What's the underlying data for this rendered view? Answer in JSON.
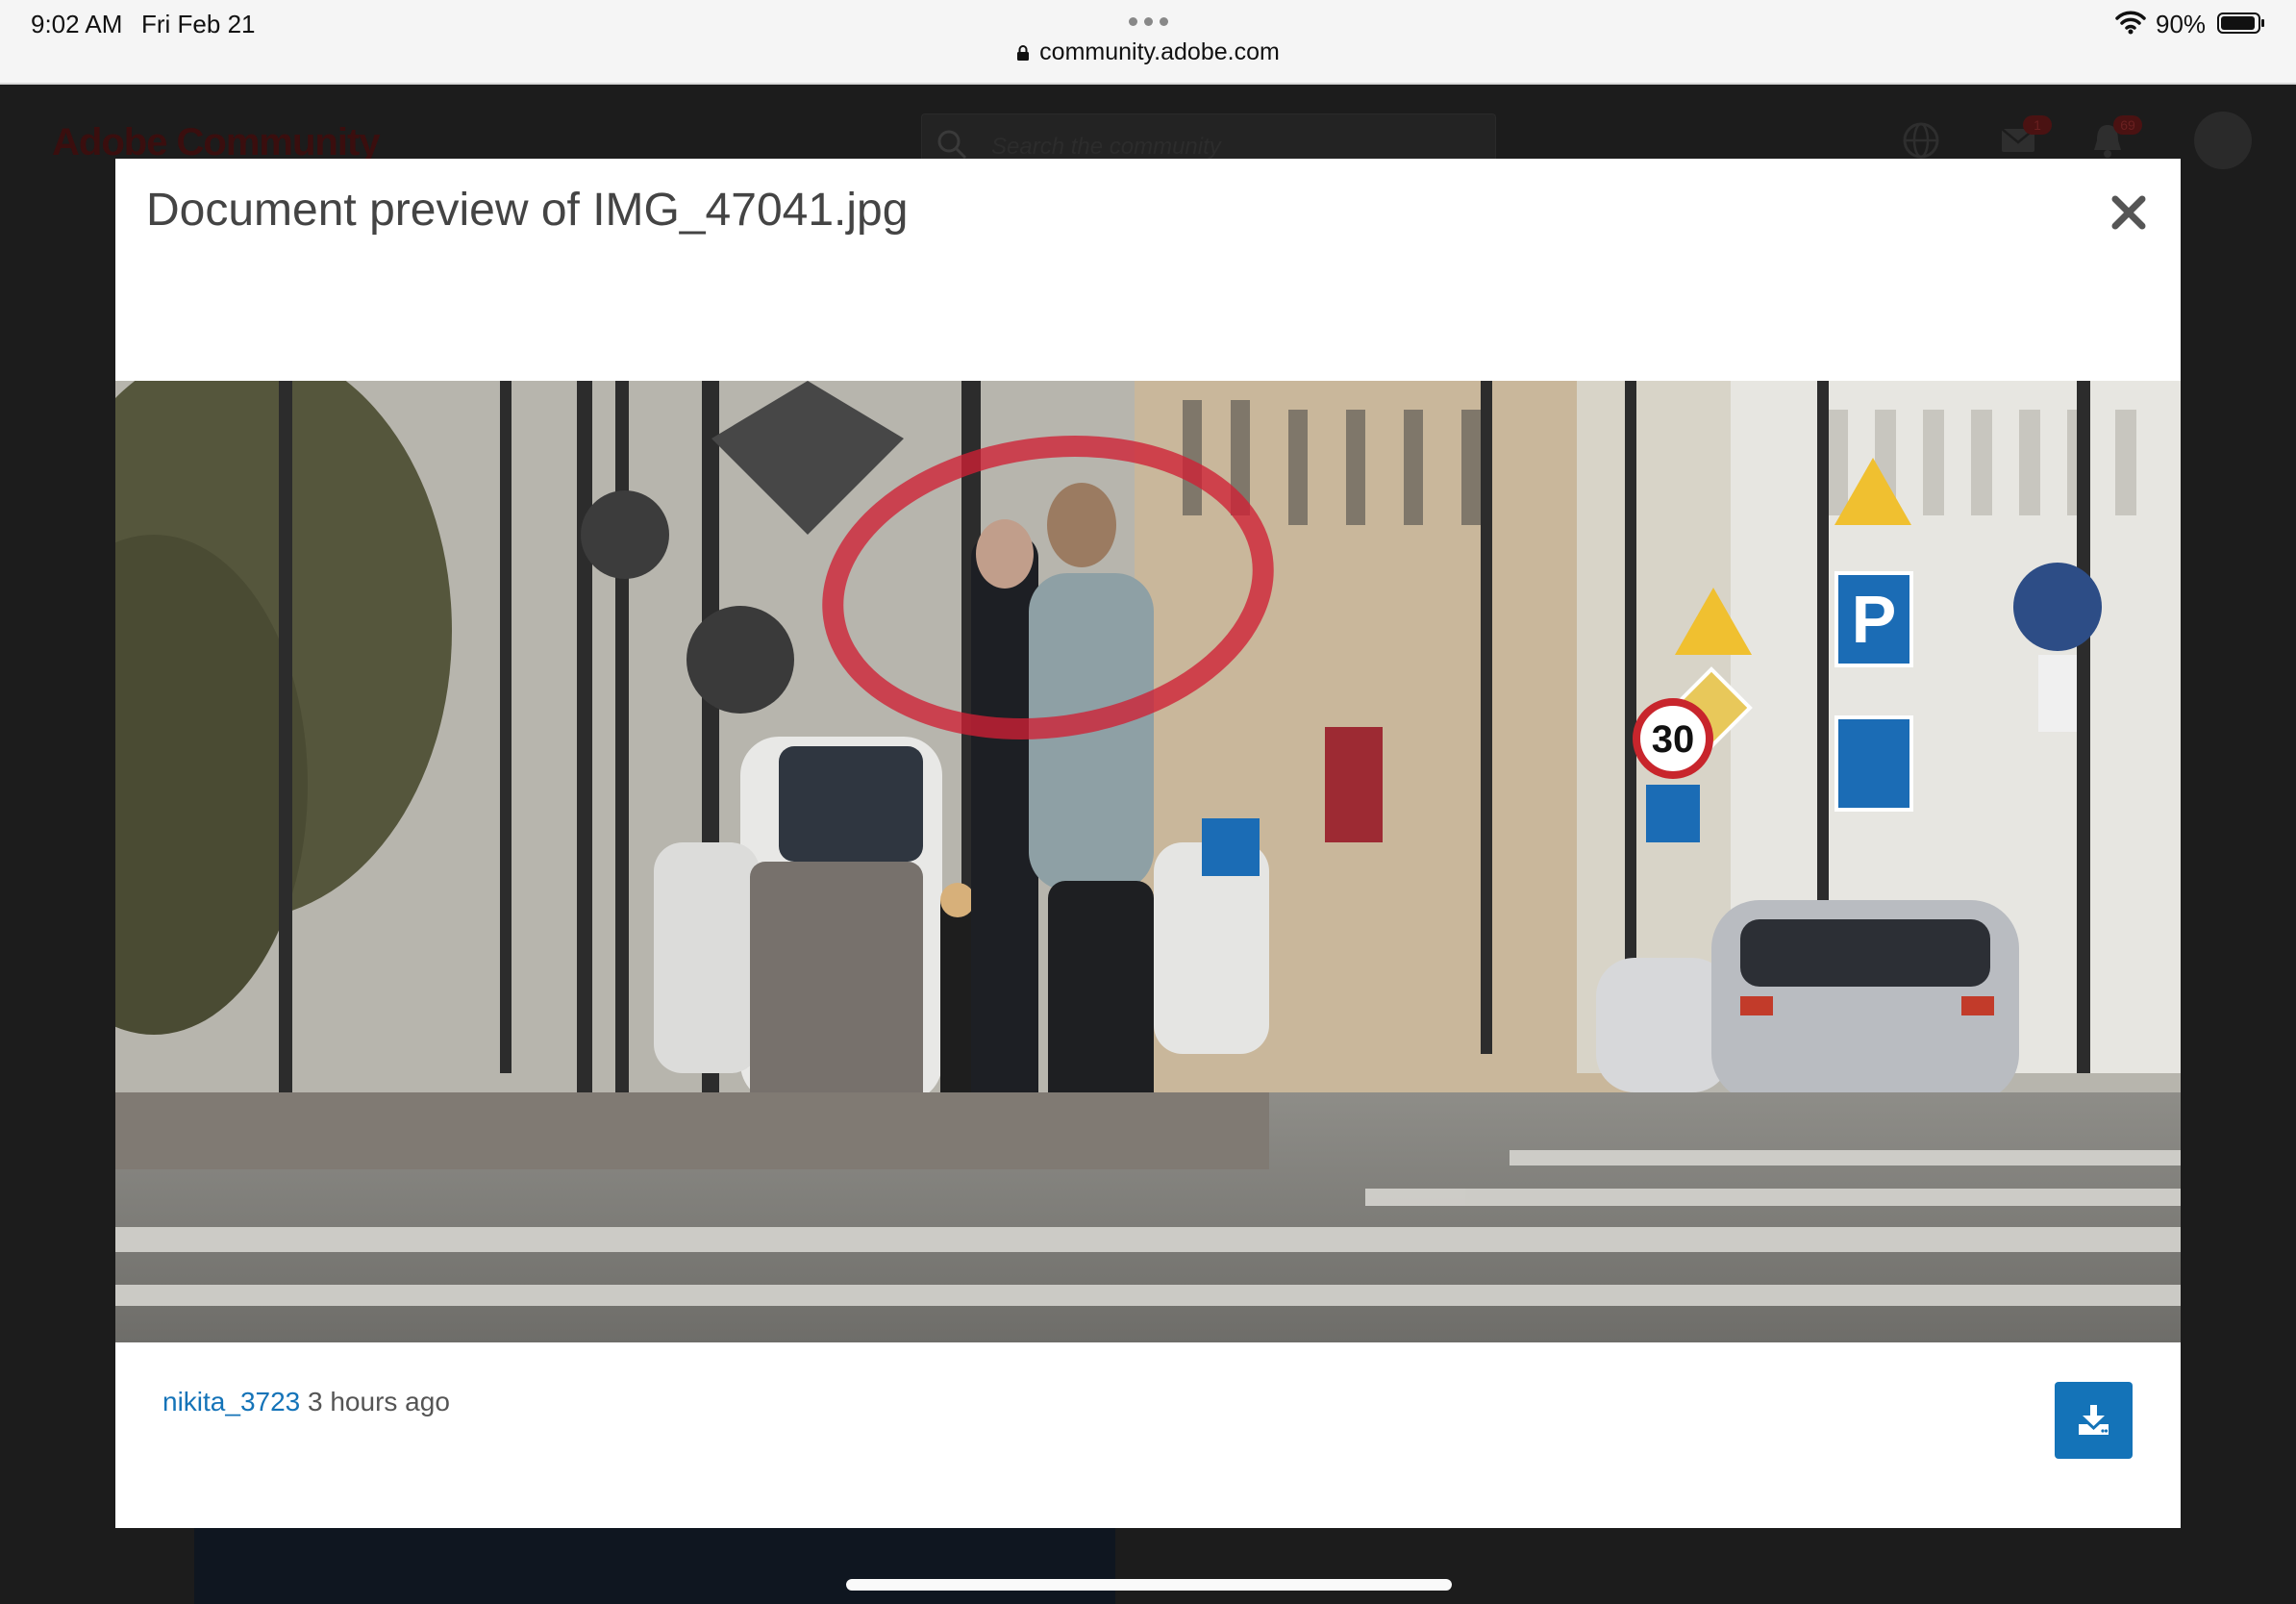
{
  "status_bar": {
    "time": "9:02 AM",
    "date": "Fri Feb 21",
    "url": "community.adobe.com",
    "battery": "90%"
  },
  "site": {
    "logo": "Adobe Community",
    "search_placeholder": "Search the community",
    "notification_counts": {
      "messages": "1",
      "alerts": "69"
    }
  },
  "modal": {
    "title": "Document preview of IMG_47041.jpg",
    "close_icon": "close-icon",
    "author": "nikita_3723",
    "time_ago": "3 hours ago",
    "download_icon": "download-icon",
    "accent_color": "#1473b8"
  },
  "preview_signs": {
    "parking_letter": "P",
    "speed_limit": "30"
  }
}
